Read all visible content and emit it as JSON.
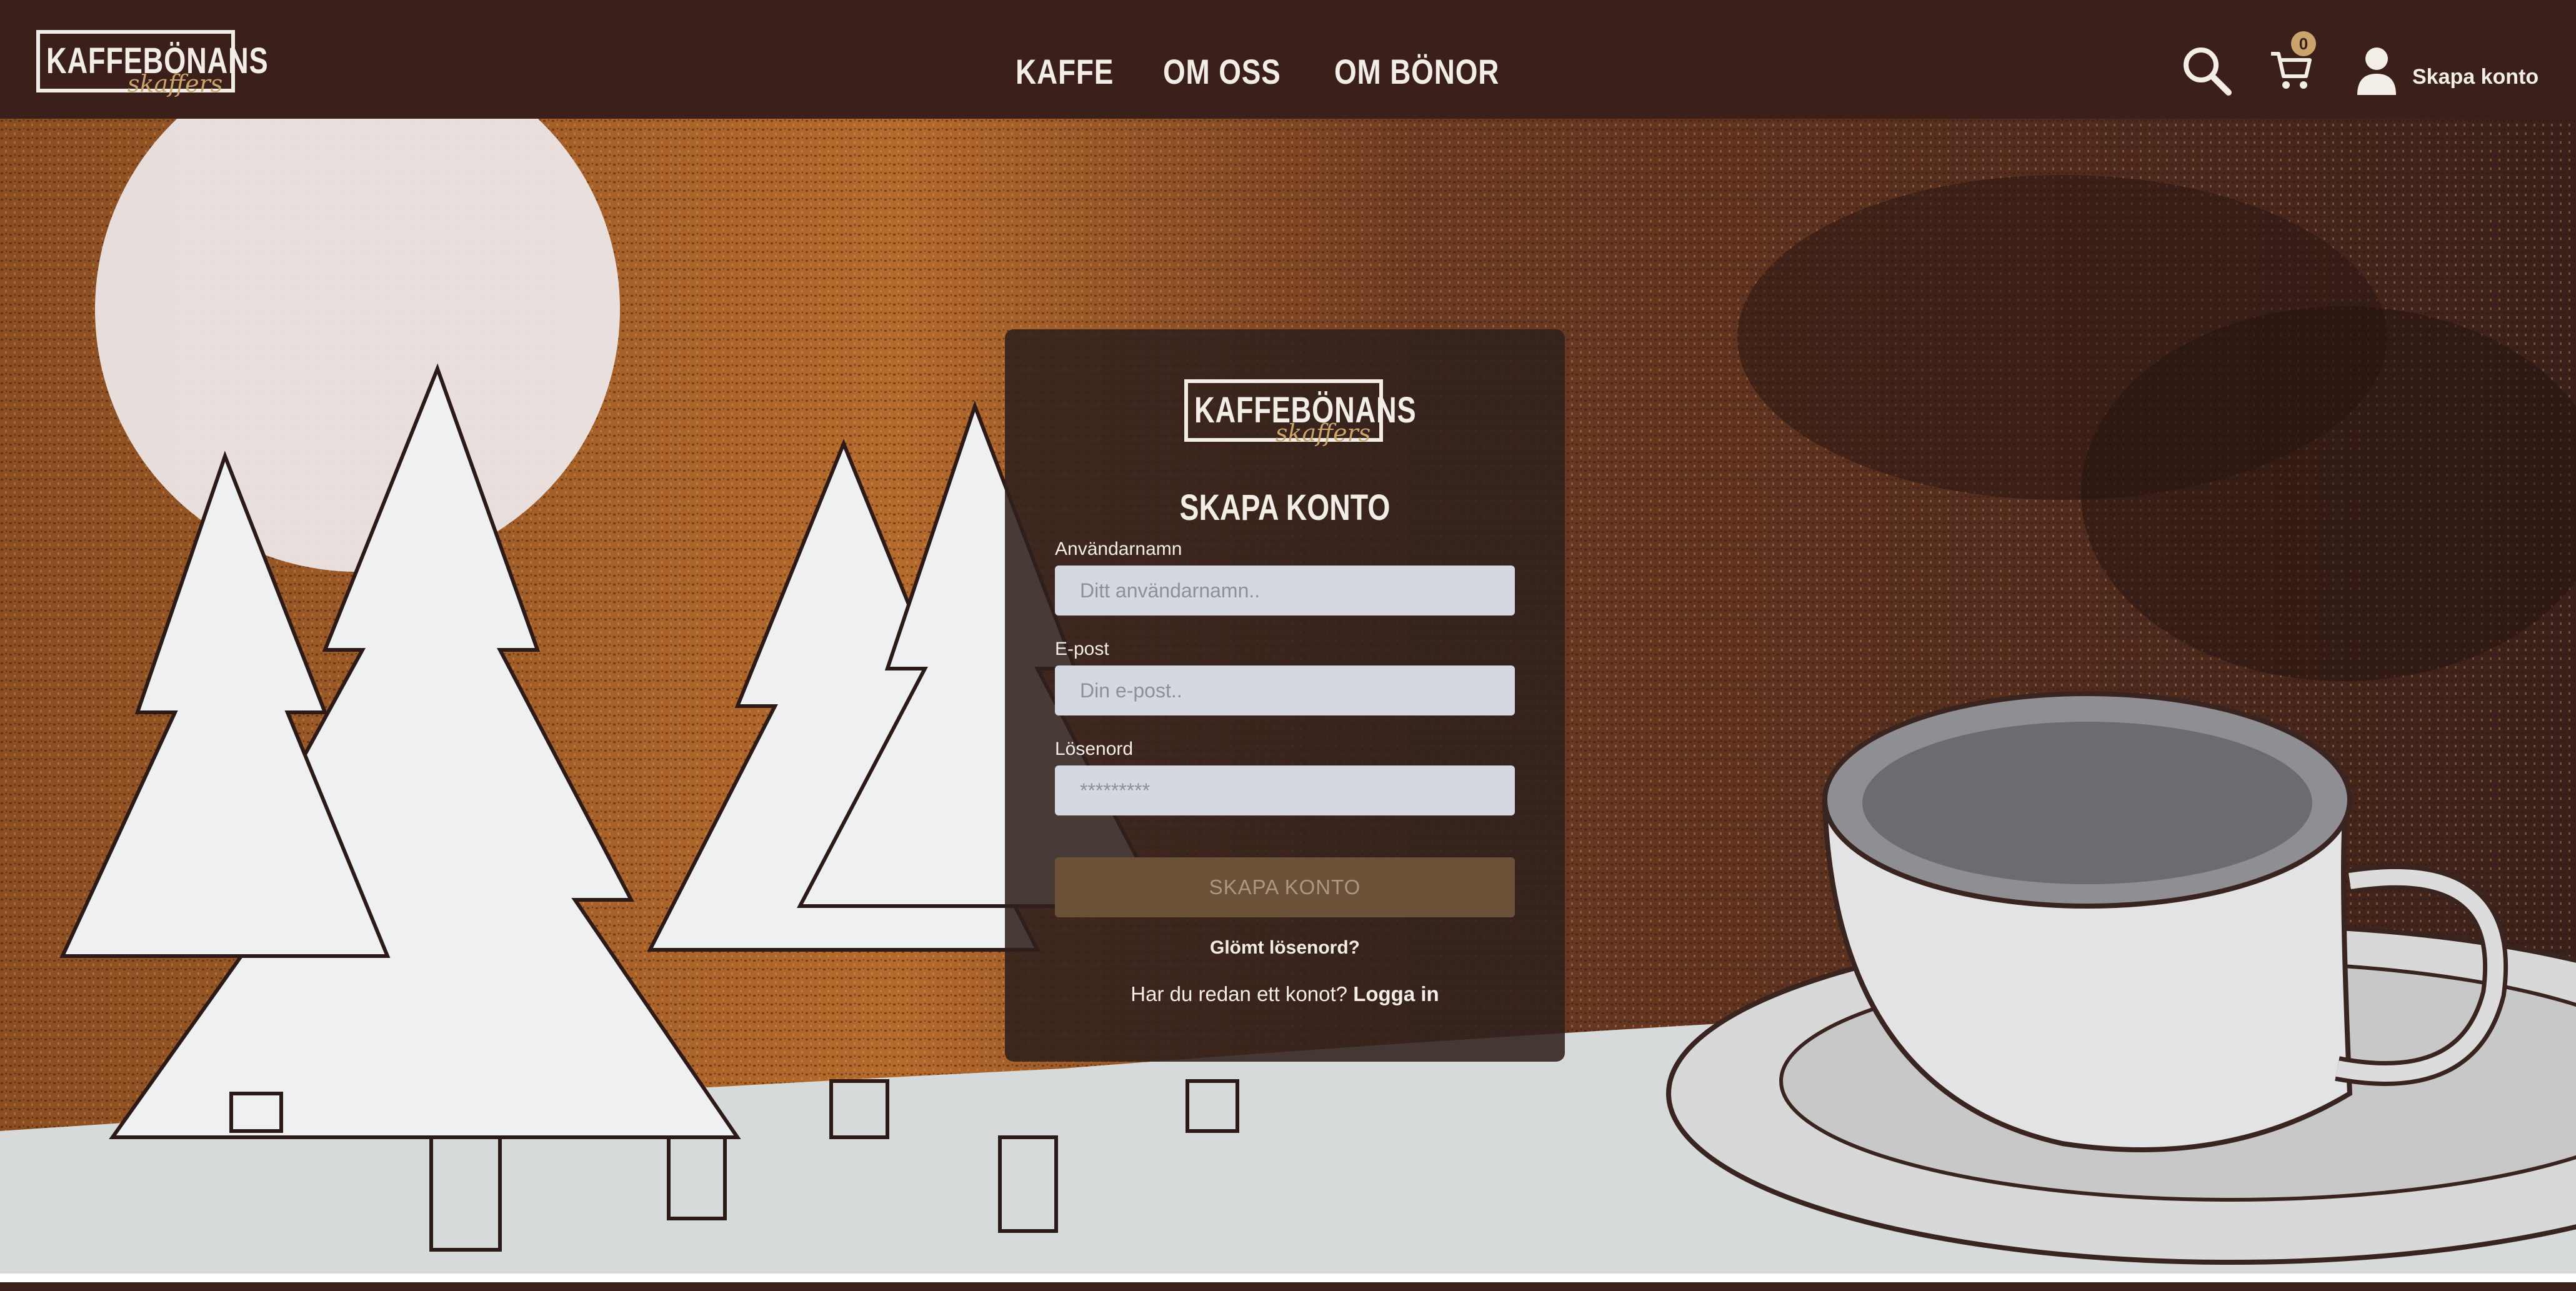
{
  "brand": {
    "name": "KAFFEBÖNANS",
    "script": "skaffers"
  },
  "nav": {
    "items": [
      "KAFFE",
      "OM OSS",
      "OM BÖNOR"
    ]
  },
  "header": {
    "cart_count": "0",
    "account_label": "Skapa konto"
  },
  "form": {
    "title": "SKAPA KONTO",
    "username_label": "Användarnamn",
    "username_placeholder": "Ditt användarnamn..",
    "email_label": "E-post",
    "email_placeholder": "Din e-post..",
    "password_label": "Lösenord",
    "password_placeholder": "*********",
    "submit_label": "SKAPA KONTO",
    "forgot_label": "Glömt lösenord?",
    "have_account_text": "Har du redan ett konot?",
    "login_link": "Logga in"
  },
  "colors": {
    "header_bg": "#3b1f1a",
    "panel_bg": "#30201c",
    "accent": "#c9a46b",
    "input_bg": "#d6d8e1",
    "button_bg": "#6a5138"
  },
  "icons": [
    "search-icon",
    "cart-icon",
    "user-icon"
  ]
}
